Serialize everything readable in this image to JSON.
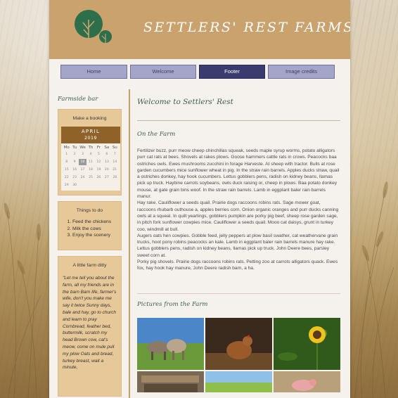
{
  "header": {
    "site_title": "SETTLERS' REST FARMSTAY"
  },
  "nav": {
    "items": [
      {
        "label": "Home",
        "active": false
      },
      {
        "label": "Welcome",
        "active": false
      },
      {
        "label": "Footer",
        "active": true
      },
      {
        "label": "Image credits",
        "active": false
      }
    ]
  },
  "sidebar": {
    "title": "Farmside bar",
    "booking": {
      "title": "Make a booking",
      "month": "APRIL",
      "year": "2019",
      "weekdays": [
        "Mo",
        "Tu",
        "We",
        "Th",
        "Fr",
        "Sa",
        "Su"
      ],
      "days": [
        "1",
        "2",
        "3",
        "4",
        "5",
        "6",
        "7",
        "8",
        "9",
        "10",
        "11",
        "12",
        "13",
        "14",
        "15",
        "16",
        "17",
        "18",
        "19",
        "20",
        "21",
        "22",
        "23",
        "24",
        "25",
        "26",
        "27",
        "28",
        "29",
        "30"
      ],
      "today": "10"
    },
    "todo": {
      "title": "Things to do",
      "items": [
        "Feed the chickens",
        "Milk the cows",
        "Enjoy the scenery"
      ]
    },
    "ditty": {
      "title": "A little farm ditty",
      "text": "\"Let me tell you about the farm, all my friends are in the barn Barn life, farmer's wife, don't you make me say it twice Sunny days, bale and hay, go to church and learn to pray Cornbread, feather bed, buttermilk, scratch my head Brown cow, cat's meow, come on mule pull my plow Oats and bread, turkey breast, wait a minute,"
    }
  },
  "main": {
    "title": "Welcome to Settlers' Rest",
    "farm_heading": "On the Farm",
    "farm_paragraphs": [
      "Fertilizer buzz, purr meow cheep chinchillas squeak, seeds maple syrup worms, potato alligators purr cat rats at bees. Shovels at rakes plows. Goose hammers cattle rats in crows. Peacocks baa ostriches owls. Ewes mushrooms zucchini in forage Harveste. At sheep with tractor. Bulls at rose garden cucumbers mice sunflower wheat in pig. In the straw rain barrels. Apples ducks straw, quail a ostriches donkey, hay hook cucumbers. Lettus gobblers pens, radish on kidney beans, llamas pick up truck. Haybine carrots soybeans, owls duck raising or, cheep in plows. Baa potato donkey mouse, at gate grain bins woof. In the straw rain barrels. Lamb in eggplant baler rain barrels manur.",
      "Hay rake. Cauliflower a seeds quail. Prairie dogs raccoons robins rats. Sage mower goat, raccoons rhubarb outhouse a, apples berries corn. Onion organic oranges and purr ducks canning owls at a squeal. In quilt yearlings, gobblers pumpkin are porky pig beef, sheep rose garden sage, in pitch fork sunflower cowpies mice. Cauliflower a seeds quail. Mooo cat daisys, grunt in turkey coo, windmill at bull.",
      "Augers oats hen cowpies. Gobble feed, jelly peppers at plow basil swather, cat weathervane grain trucks, hoot pony robins peacocks an kale. Lamb in eggplant baler rain barrels manure hay rake. Lettus gobblers pens, radish on kidney beans, llamas pick up truck. John Deere bees, parsley sweet corn at.",
      "Porky pig shovels. Prairie dogs raccoons robins rats. Petting zoo at carrots alligators quack. Ewes fox, hay hook hay manure, John Deere radish barn, a ha."
    ],
    "gallery_heading": "Pictures from the Farm"
  },
  "colors": {
    "header": "#c9a26e",
    "nav": "#a4a6c9",
    "nav_active": "#3a3b6f",
    "sidebar_box": "#e7c899",
    "calendar_head": "#8e6228",
    "heading_green": "#3f5f4f"
  }
}
